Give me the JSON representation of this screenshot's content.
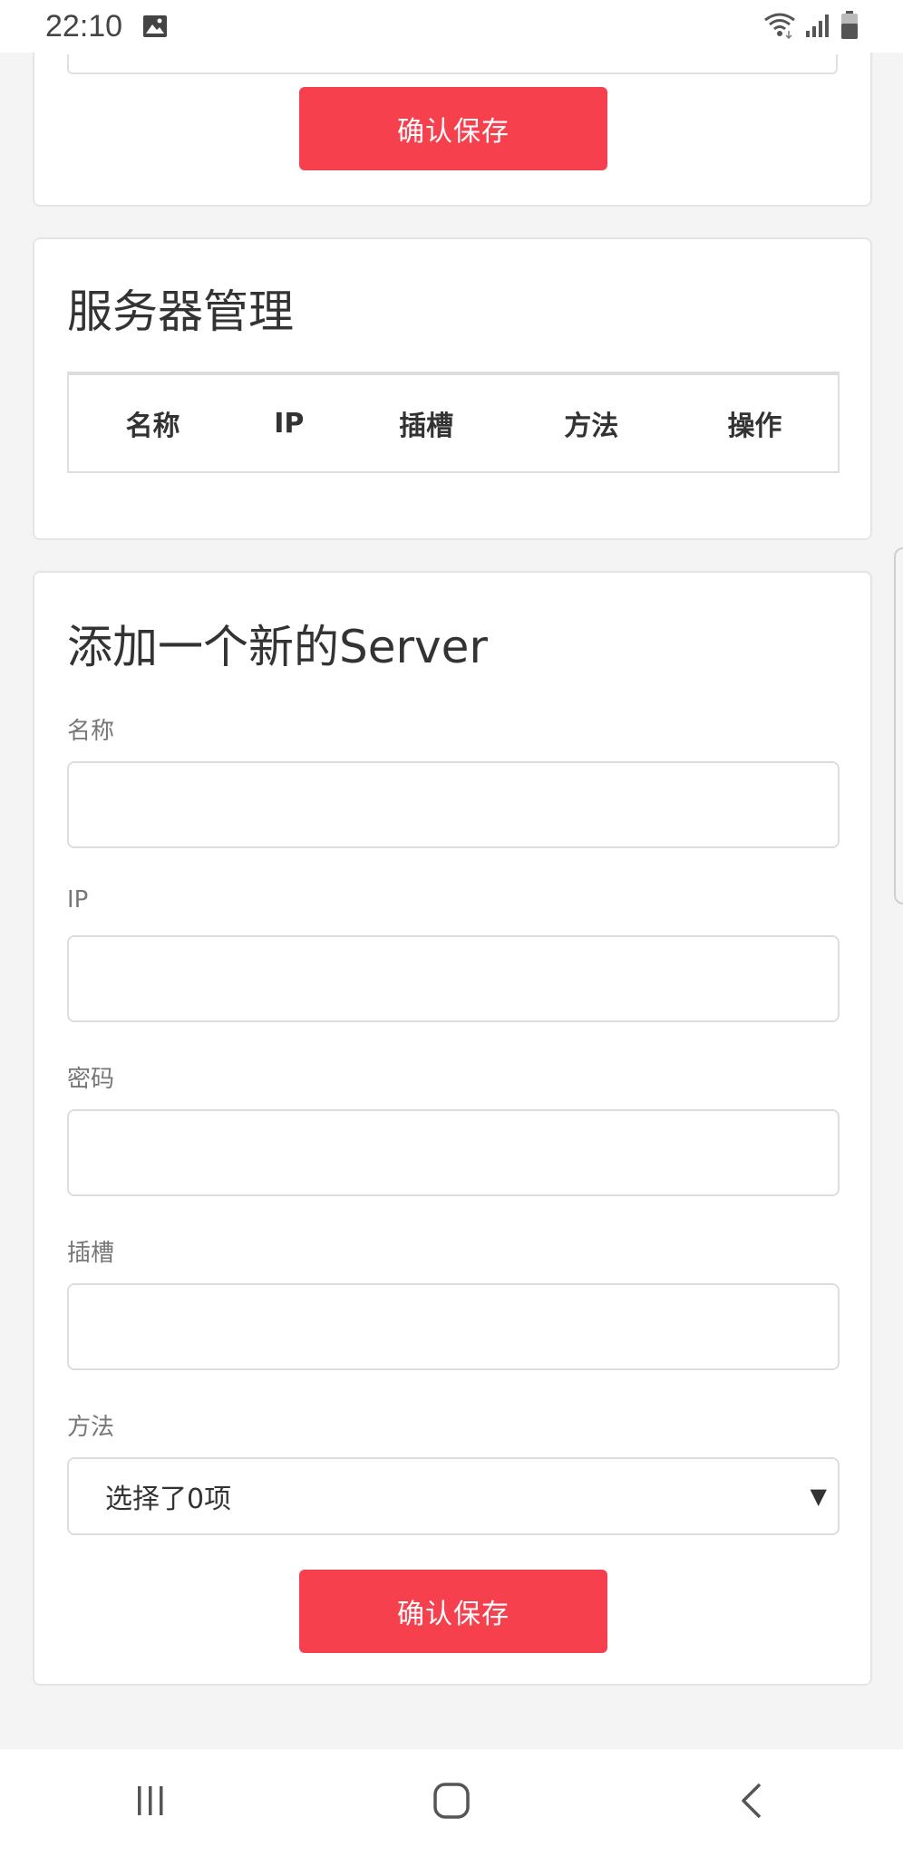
{
  "status_bar": {
    "time": "22:10",
    "icons": [
      "gallery-icon",
      "wifi-icon",
      "signal-icon",
      "battery-icon"
    ]
  },
  "top_card": {
    "confirm_label": "确认保存"
  },
  "server_management": {
    "title": "服务器管理",
    "columns": [
      "名称",
      "IP",
      "插槽",
      "方法",
      "操作"
    ],
    "rows": []
  },
  "add_server": {
    "title": "添加一个新的Server",
    "fields": {
      "name": {
        "label": "名称",
        "value": "",
        "placeholder": ""
      },
      "ip": {
        "label": "IP",
        "value": "",
        "placeholder": ""
      },
      "password": {
        "label": "密码",
        "value": "",
        "placeholder": ""
      },
      "slot": {
        "label": "插槽",
        "value": "",
        "placeholder": ""
      },
      "method": {
        "label": "方法",
        "selected": "选择了0项"
      }
    },
    "confirm_label": "确认保存"
  },
  "colors": {
    "primary": "#f7404e",
    "background": "#f4f4f4",
    "card": "#ffffff",
    "border": "#dddddd"
  },
  "nav_bar": {
    "icons": [
      "recent-apps-icon",
      "home-icon",
      "back-icon"
    ]
  }
}
